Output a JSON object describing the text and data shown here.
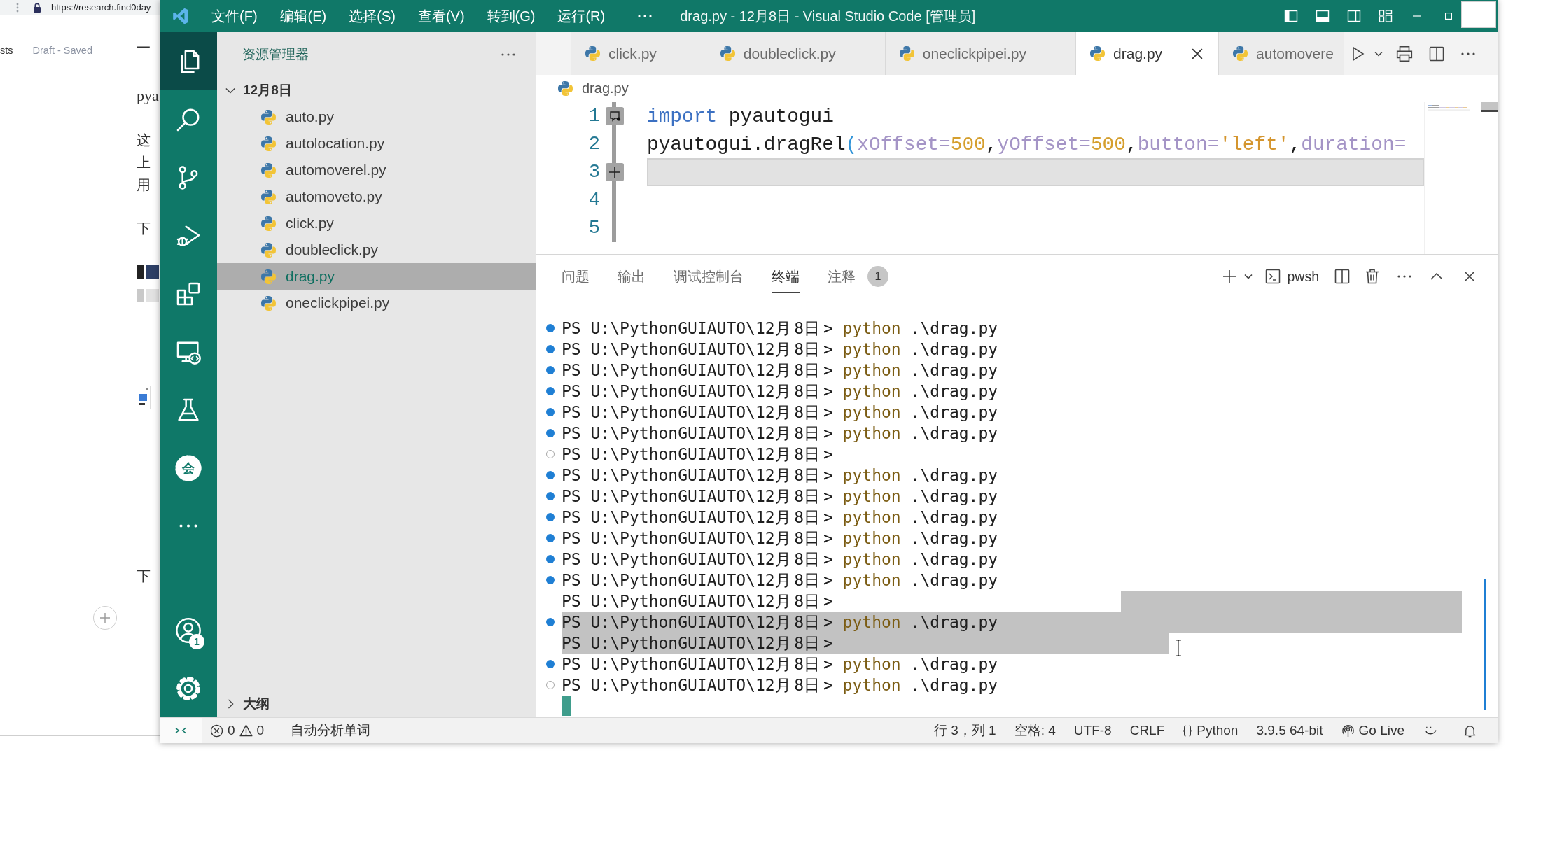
{
  "browser": {
    "url": "https://research.find0day",
    "nav": "sts",
    "status": "Draft - Saved",
    "article": [
      {
        "kind": "paragraph",
        "lines": [
          "一"
        ]
      },
      {
        "kind": "heading",
        "text": "pya"
      },
      {
        "kind": "paragraph",
        "lines": [
          "这",
          "上",
          "用"
        ]
      },
      {
        "kind": "paragraph",
        "lines": [
          "下"
        ]
      },
      {
        "kind": "images"
      },
      {
        "kind": "widget"
      },
      {
        "kind": "paragraph",
        "lines": [
          "下"
        ]
      }
    ]
  },
  "title_bar": {
    "menus": [
      "文件(F)",
      "编辑(E)",
      "选择(S)",
      "查看(V)",
      "转到(G)",
      "运行(R)"
    ],
    "title": "drag.py - 12月8日 - Visual Studio Code [管理员]"
  },
  "activity_bar": {
    "items": [
      {
        "kind": "files",
        "selected": true
      },
      {
        "kind": "search",
        "selected": false
      },
      {
        "kind": "branch",
        "selected": false
      },
      {
        "kind": "run",
        "selected": false
      },
      {
        "kind": "extensions",
        "selected": false
      },
      {
        "kind": "remote",
        "selected": false
      },
      {
        "kind": "flask",
        "selected": false
      },
      {
        "kind": "seal",
        "glyph": "会",
        "selected": false
      },
      {
        "kind": "more",
        "selected": false
      }
    ],
    "bottom": [
      {
        "kind": "account",
        "badge": "1"
      },
      {
        "kind": "gear"
      }
    ]
  },
  "sidebar": {
    "title": "资源管理器",
    "folder": {
      "name": "12月8日",
      "expanded": true,
      "children": [
        {
          "name": "auto.py",
          "selected": false
        },
        {
          "name": "autolocation.py",
          "selected": false
        },
        {
          "name": "automoverel.py",
          "selected": false
        },
        {
          "name": "automoveto.py",
          "selected": false
        },
        {
          "name": "click.py",
          "selected": false
        },
        {
          "name": "doubleclick.py",
          "selected": false
        },
        {
          "name": "drag.py",
          "selected": true
        },
        {
          "name": "oneclickpipei.py",
          "selected": false
        }
      ]
    },
    "outline": {
      "name": "大纲",
      "expanded": false
    }
  },
  "editor": {
    "tabs": [
      {
        "label": "click.py",
        "selected": false
      },
      {
        "label": "doubleclick.py",
        "selected": false
      },
      {
        "label": "oneclickpipei.py",
        "selected": false
      },
      {
        "label": "drag.py",
        "selected": true
      },
      {
        "label": "automovere",
        "selected": false
      }
    ],
    "breadcrumb": "drag.py",
    "lines": [
      {
        "number": "1",
        "kind": "comment",
        "current": false,
        "tokens": [
          {
            "kind": "keyword",
            "text": "import"
          },
          {
            "kind": "plain",
            "text": " pyautogui"
          }
        ]
      },
      {
        "number": "2",
        "kind": "plain",
        "current": false,
        "tokens": [
          {
            "kind": "plain",
            "text": "pyautogui.dragRel"
          },
          {
            "kind": "bracket",
            "text": "("
          },
          {
            "kind": "param",
            "text": "xOffset="
          },
          {
            "kind": "number",
            "text": "500"
          },
          {
            "kind": "plain",
            "text": ","
          },
          {
            "kind": "param",
            "text": "yOffset="
          },
          {
            "kind": "number",
            "text": "500"
          },
          {
            "kind": "plain",
            "text": ","
          },
          {
            "kind": "param",
            "text": "button="
          },
          {
            "kind": "string",
            "text": "'left'"
          },
          {
            "kind": "plain",
            "text": ","
          },
          {
            "kind": "param",
            "text": "duration="
          }
        ]
      },
      {
        "number": "3",
        "kind": "add",
        "current": true
      },
      {
        "number": "4",
        "kind": "plain",
        "current": false
      },
      {
        "number": "5",
        "kind": "plain",
        "current": false
      }
    ]
  },
  "panel": {
    "tabs": [
      {
        "label": "问题",
        "selected": false
      },
      {
        "label": "输出",
        "selected": false
      },
      {
        "label": "调试控制台",
        "selected": false
      },
      {
        "label": "终端",
        "selected": true
      },
      {
        "label": "注释",
        "selected": false,
        "badge": "1"
      }
    ],
    "shell": "pwsh",
    "terminal": [
      {
        "kind": "filled",
        "prompt": "PS U:\\PythonGUIAUTO\\12月8日>",
        "command": "python",
        "argument": ".\\drag.py",
        "selected": false
      },
      {
        "kind": "filled",
        "prompt": "PS U:\\PythonGUIAUTO\\12月8日>",
        "command": "python",
        "argument": ".\\drag.py",
        "selected": false
      },
      {
        "kind": "filled",
        "prompt": "PS U:\\PythonGUIAUTO\\12月8日>",
        "command": "python",
        "argument": ".\\drag.py",
        "selected": false
      },
      {
        "kind": "filled",
        "prompt": "PS U:\\PythonGUIAUTO\\12月8日>",
        "command": "python",
        "argument": ".\\drag.py",
        "selected": false
      },
      {
        "kind": "filled",
        "prompt": "PS U:\\PythonGUIAUTO\\12月8日>",
        "command": "python",
        "argument": ".\\drag.py",
        "selected": false
      },
      {
        "kind": "filled",
        "prompt": "PS U:\\PythonGUIAUTO\\12月8日>",
        "command": "python",
        "argument": ".\\drag.py",
        "selected": false
      },
      {
        "kind": "hollow",
        "prompt": "PS U:\\PythonGUIAUTO\\12月8日>",
        "selected": false
      },
      {
        "kind": "filled",
        "prompt": "PS U:\\PythonGUIAUTO\\12月8日>",
        "command": "python",
        "argument": ".\\drag.py",
        "selected": false
      },
      {
        "kind": "filled",
        "prompt": "PS U:\\PythonGUIAUTO\\12月8日>",
        "command": "python",
        "argument": ".\\drag.py",
        "selected": false
      },
      {
        "kind": "filled",
        "prompt": "PS U:\\PythonGUIAUTO\\12月8日>",
        "command": "python",
        "argument": ".\\drag.py",
        "selected": false
      },
      {
        "kind": "filled",
        "prompt": "PS U:\\PythonGUIAUTO\\12月8日>",
        "command": "python",
        "argument": ".\\drag.py",
        "selected": false
      },
      {
        "kind": "filled",
        "prompt": "PS U:\\PythonGUIAUTO\\12月8日>",
        "command": "python",
        "argument": ".\\drag.py",
        "selected": false
      },
      {
        "kind": "filled",
        "prompt": "PS U:\\PythonGUIAUTO\\12月8日>",
        "command": "python",
        "argument": ".\\drag.py",
        "selected": false
      },
      {
        "kind": "plain",
        "prompt": "PS U:\\PythonGUIAUTO\\12月8日>",
        "selected": true
      },
      {
        "kind": "filled",
        "prompt": "PS U:\\PythonGUIAUTO\\12月8日>",
        "command": "python",
        "argument": ".\\drag.py",
        "selected": true
      },
      {
        "kind": "plain",
        "prompt": "PS U:\\PythonGUIAUTO\\12月8日>",
        "selected": true
      },
      {
        "kind": "filled",
        "prompt": "PS U:\\PythonGUIAUTO\\12月8日>",
        "command": "python",
        "argument": ".\\drag.py",
        "selected": false
      },
      {
        "kind": "hollow",
        "prompt": "PS U:\\PythonGUIAUTO\\12月8日>",
        "command": "python",
        "argument": ".\\drag.py",
        "selected": false
      }
    ]
  },
  "status_bar": {
    "errors": "0",
    "warnings": "0",
    "left": [
      "自动分析单词"
    ],
    "right": [
      {
        "kind": "text",
        "label": "行 3，列 1"
      },
      {
        "kind": "text",
        "label": "空格: 4"
      },
      {
        "kind": "text",
        "label": "UTF-8"
      },
      {
        "kind": "text",
        "label": "CRLF"
      },
      {
        "kind": "language",
        "label": "Python"
      },
      {
        "kind": "text",
        "label": "3.9.5 64-bit"
      },
      {
        "kind": "live",
        "label": "Go Live"
      },
      {
        "kind": "feedback"
      },
      {
        "kind": "bell"
      }
    ]
  }
}
